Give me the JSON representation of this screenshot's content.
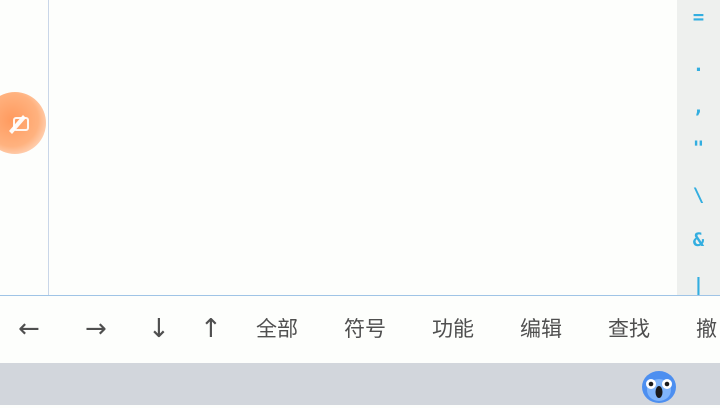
{
  "symbol_rail": {
    "items": [
      "=",
      ".",
      ",",
      "\"",
      "\\",
      "&",
      "|"
    ]
  },
  "toolbar": {
    "left_arrow": "←",
    "right_arrow": "→",
    "down_arrow": "↓",
    "up_arrow": "↑",
    "all": "全部",
    "symbols": "符号",
    "functions": "功能",
    "edit": "编辑",
    "find": "查找",
    "undo": "撤"
  },
  "colors": {
    "symbol_accent": "#33aee0",
    "fab_orange": "#ff9a5e",
    "toolbar_text": "#4f4f4f",
    "system_bar": "#d2d6dc"
  },
  "icons": {
    "fab": "paint-brush-icon",
    "assistant": "bird-mascot-icon"
  }
}
